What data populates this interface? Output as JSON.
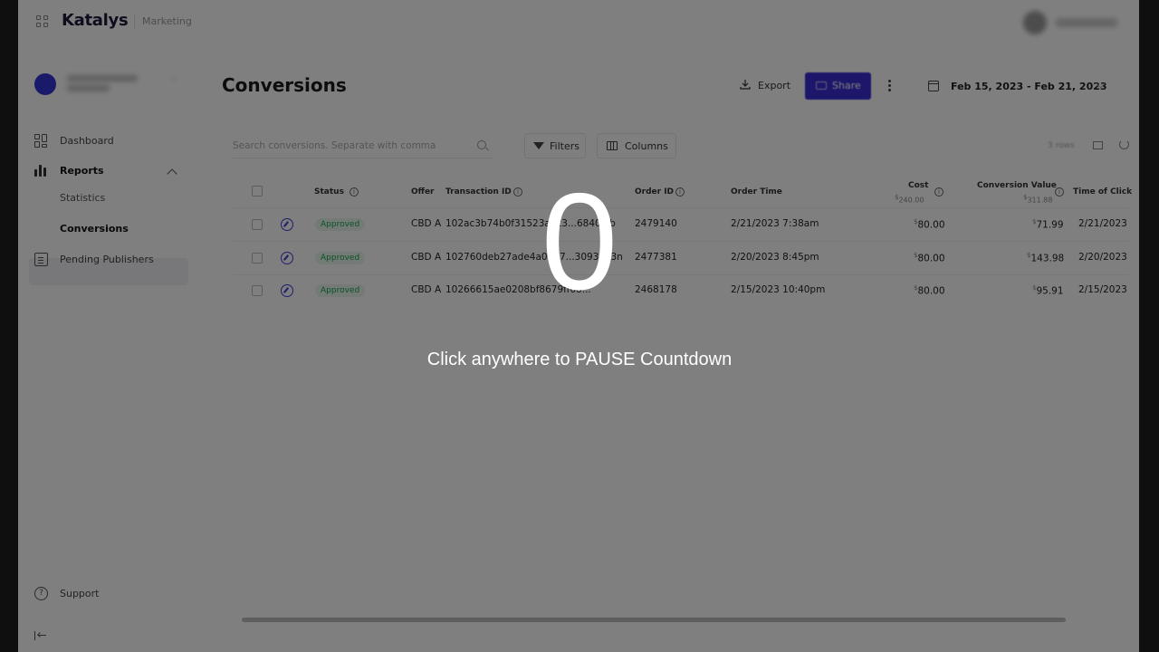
{
  "app": {
    "brand": "Katalys",
    "workspace": "Marketing"
  },
  "sidebar": {
    "items": [
      {
        "label": "Dashboard",
        "icon": "dashboard-icon"
      },
      {
        "label": "Reports",
        "icon": "bar-chart-icon"
      },
      {
        "label": "Pending Publishers",
        "icon": "document-icon"
      }
    ],
    "reports_sub": [
      {
        "label": "Statistics"
      },
      {
        "label": "Conversions"
      }
    ],
    "support": "Support"
  },
  "page": {
    "title": "Conversions"
  },
  "toolbar": {
    "export_label": "Export",
    "share_label": "Share",
    "date_range": "Feb 15, 2023  - Feb 21, 2023",
    "search_placeholder": "Search conversions. Separate with comma",
    "filters_label": "Filters",
    "columns_label": "Columns",
    "rows_count": "3 rows"
  },
  "table": {
    "headers": {
      "status": "Status",
      "offer": "Offer",
      "transaction_id": "Transaction ID",
      "order_id": "Order ID",
      "order_time": "Order Time",
      "cost": "Cost",
      "cost_total_symbol": "$",
      "cost_total": "240.00",
      "conversion_value": "Conversion Value",
      "conversion_value_total_symbol": "$",
      "conversion_value_total": "311.88",
      "time_of_click": "Time of Click"
    },
    "rows": [
      {
        "status": "Approved",
        "offer": "CBD A",
        "transaction_id": "102ac3b74b0f31523abc3...6840leb",
        "order_id": "2479140",
        "order_time": "2/21/2023 7:38am",
        "cost_symbol": "$",
        "cost": "80.00",
        "value_symbol": "$",
        "value": "71.99",
        "time_of_click": "2/21/2023"
      },
      {
        "status": "Approved",
        "offer": "CBD A",
        "transaction_id": "102760deb27ade4a0467...30935a3n",
        "order_id": "2477381",
        "order_time": "2/20/2023 8:45pm",
        "cost_symbol": "$",
        "cost": "80.00",
        "value_symbol": "$",
        "value": "143.98",
        "time_of_click": "2/20/2023"
      },
      {
        "status": "Approved",
        "offer": "CBD A",
        "transaction_id": "10266615ae0208bf8679ff68...",
        "order_id": "2468178",
        "order_time": "2/15/2023 10:40pm",
        "cost_symbol": "$",
        "cost": "80.00",
        "value_symbol": "$",
        "value": "95.91",
        "time_of_click": "2/15/2023"
      }
    ]
  },
  "overlay": {
    "countdown": "0",
    "message": "Click anywhere to PAUSE Countdown"
  }
}
